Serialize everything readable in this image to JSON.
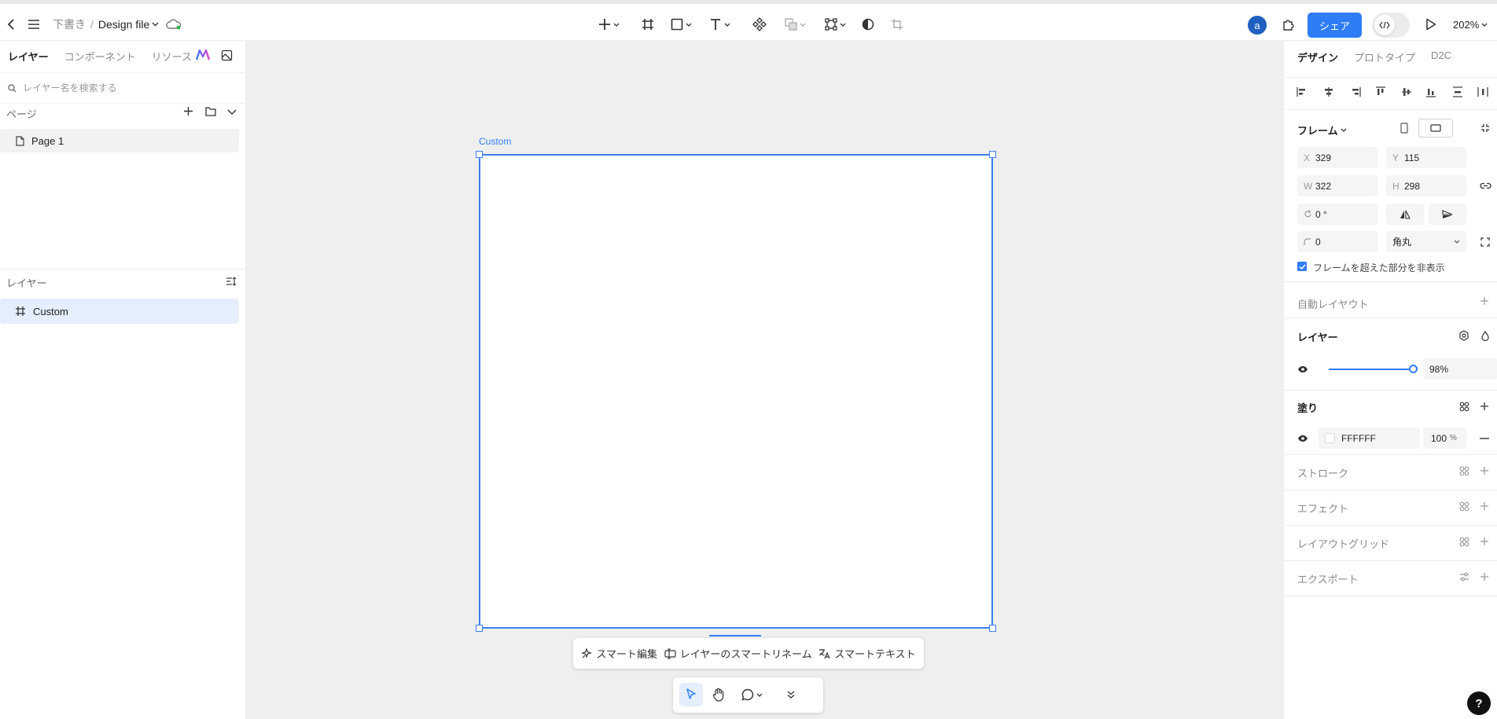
{
  "header": {
    "breadcrumb_folder": "下書き",
    "breadcrumb_sep": "/",
    "file_name": "Design file",
    "avatar_initial": "a",
    "share_label": "シェア",
    "zoom": "202%"
  },
  "left_panel": {
    "tabs": [
      "レイヤー",
      "コンポーネント",
      "リソース"
    ],
    "search_placeholder": "レイヤー名を検索する",
    "pages_title": "ページ",
    "pages": [
      "Page 1"
    ],
    "layers_title": "レイヤー",
    "layers": [
      "Custom"
    ]
  },
  "canvas": {
    "frame_label": "Custom",
    "smart_actions": [
      "スマート編集",
      "レイヤーのスマートリネーム",
      "スマートテキスト"
    ]
  },
  "right_panel": {
    "tabs": [
      "デザイン",
      "プロトタイプ",
      "D2C"
    ],
    "frame_title": "フレーム",
    "x_label": "X",
    "x_value": "329",
    "y_label": "Y",
    "y_value": "115",
    "w_label": "W",
    "w_value": "322",
    "h_label": "H",
    "h_value": "298",
    "rotation": "0 °",
    "radius": "0",
    "corner_type": "角丸",
    "clip_label": "フレームを超えた部分を非表示",
    "auto_layout": "自動レイヤウト",
    "layer_title": "レイヤー",
    "opacity": "98%",
    "opacity_value": 0.98,
    "fill_title": "塗り",
    "fill_hex": "FFFFFF",
    "fill_opacity": "100",
    "fill_pct": "%",
    "stroke": "ストローク",
    "effect": "エフェクト",
    "layout_grid": "レイアウトグリッド",
    "export": "エクスポート"
  },
  "help_label": "?",
  "colors": {
    "accent": "#2e7df6",
    "selection": "#3b7ff2",
    "canvas_bg": "#efefef"
  }
}
